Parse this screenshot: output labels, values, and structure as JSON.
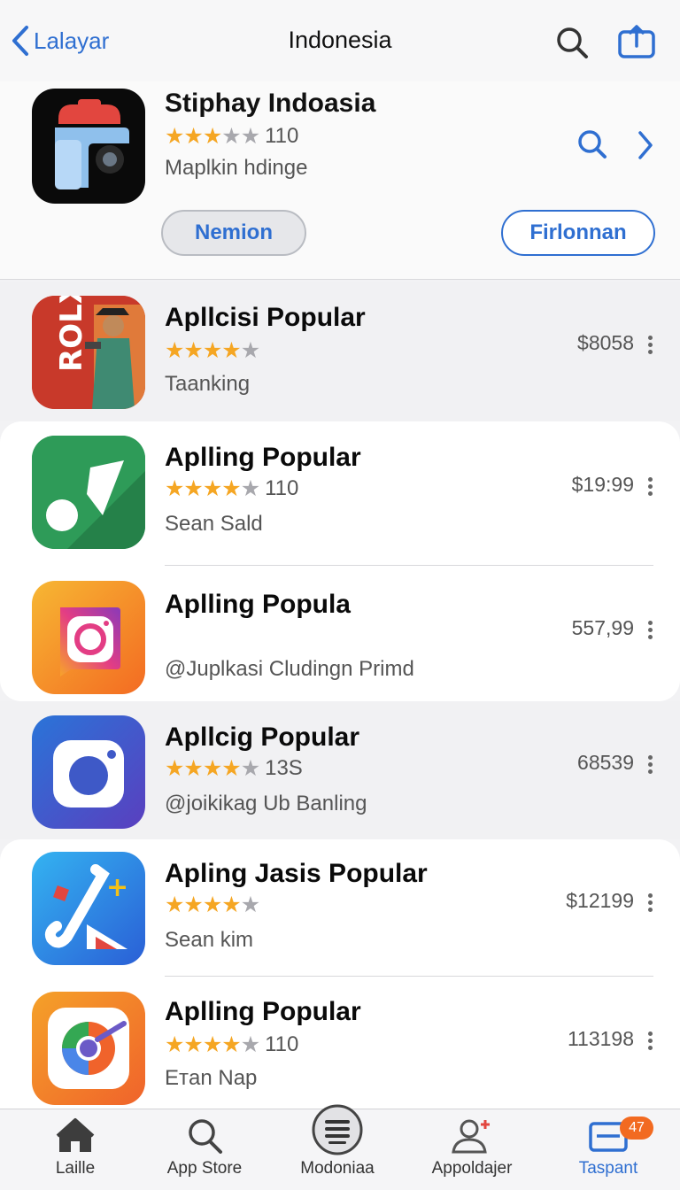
{
  "nav": {
    "back_label": "Lalayar",
    "title": "Indonesia"
  },
  "featured": {
    "name": "Stiphay Indoasia",
    "stars": 3.5,
    "rating_count": "110",
    "subtitle": "Maplkin hdinge",
    "left_button": "Nemion",
    "right_button": "Firlonnan"
  },
  "apps": [
    {
      "name": "Apllcisi Popular",
      "stars": 4.5,
      "rating_count": "",
      "subtitle": "Taanking",
      "price": "$8058",
      "icon": "roblox-style-icon"
    },
    {
      "name": "Aplling Popular",
      "stars": 4.5,
      "rating_count": "110",
      "subtitle": "Sean Sald",
      "price": "$19:99",
      "icon": "music-note-icon"
    },
    {
      "name": "Aplling Popula",
      "stars": null,
      "rating_count": "",
      "subtitle": "@Juplkasi Cludingn Primd",
      "price": "557,99",
      "icon": "instagram-style-icon"
    },
    {
      "name": "Apllcig Popular",
      "stars": 4.5,
      "rating_count": "13S",
      "subtitle": "@joikikag Ub Banling",
      "price": "68539",
      "icon": "camera-icon"
    },
    {
      "name": "Apling Jasis Popular",
      "stars": 4.5,
      "rating_count": "",
      "subtitle": "Sean kim",
      "price": "$12199",
      "icon": "design-tools-icon"
    },
    {
      "name": "Aplling Popular",
      "stars": 4.5,
      "rating_count": "110",
      "subtitle": "Eтan Nap",
      "price": "113198",
      "icon": "browser-style-icon"
    }
  ],
  "tabs": [
    {
      "label": "Laille",
      "icon": "home-icon"
    },
    {
      "label": "App Store",
      "icon": "search-icon"
    },
    {
      "label": "Modoniaa",
      "icon": "list-icon"
    },
    {
      "label": "Appoldajer",
      "icon": "user-add-icon"
    },
    {
      "label": "Taspant",
      "icon": "tray-icon",
      "badge": "47"
    }
  ],
  "colors": {
    "accent": "#2f6fd1",
    "star": "#f5a623",
    "badge": "#f26a21"
  }
}
